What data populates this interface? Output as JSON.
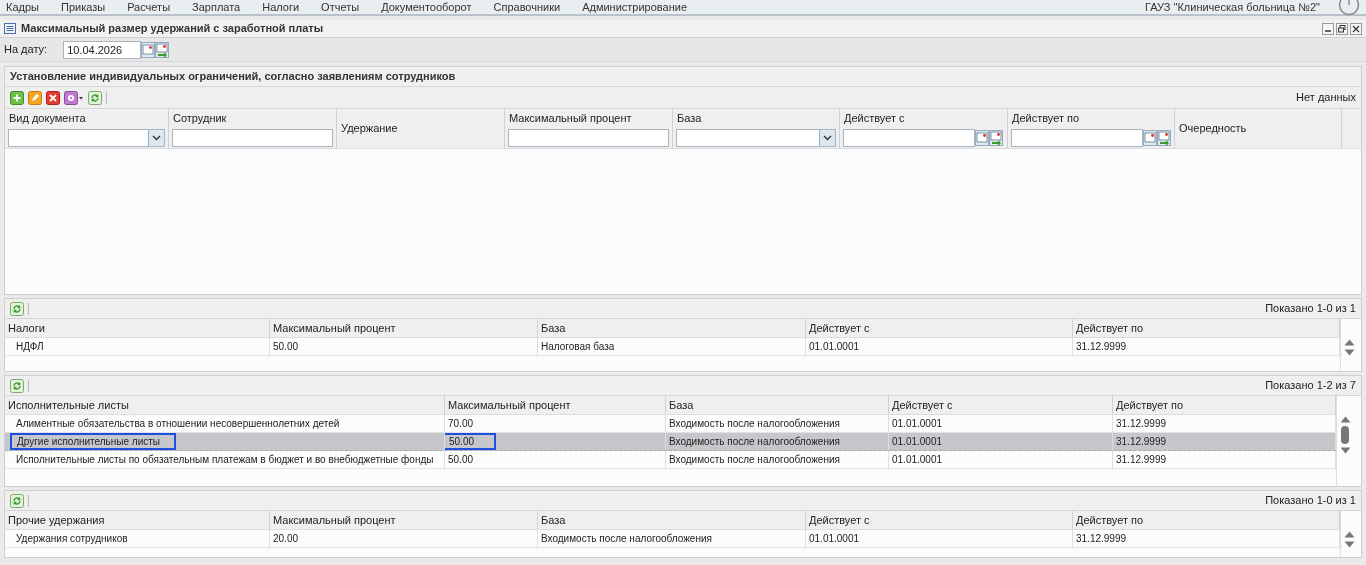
{
  "menu": [
    "Кадры",
    "Приказы",
    "Расчеты",
    "Зарплата",
    "Налоги",
    "Отчеты",
    "Документооборот",
    "Справочники",
    "Администрирование"
  ],
  "organization": "ГАУЗ \"Клиническая больница №2\"",
  "window": {
    "title": "Максимальный размер удержаний с заработной платы"
  },
  "date_filter": {
    "label": "На дату:",
    "value": "10.04.2026"
  },
  "individual_limits": {
    "title": "Установление индивидуальных ограничений, согласно заявлениям сотрудников",
    "status": "Нет данных",
    "columns": [
      {
        "label": "Вид документа",
        "kind": "dropdown"
      },
      {
        "label": "Сотрудник",
        "kind": "text"
      },
      {
        "label": "Удержание",
        "kind": "none"
      },
      {
        "label": "Максимальный процент",
        "kind": "text"
      },
      {
        "label": "База",
        "kind": "dropdown"
      },
      {
        "label": "Действует с",
        "kind": "date"
      },
      {
        "label": "Действует по",
        "kind": "date"
      },
      {
        "label": "Очередность",
        "kind": "none"
      }
    ]
  },
  "grids": [
    {
      "status": "Показано 1-0 из 1",
      "columns": [
        "Налоги",
        "Максимальный процент",
        "База",
        "Действует с",
        "Действует по"
      ],
      "rows": [
        {
          "selected": false,
          "cells": [
            {
              "text": "НДФЛ",
              "outlined": false
            },
            {
              "text": "50.00",
              "outlined": false
            },
            {
              "text": "Налоговая база",
              "outlined": false
            },
            {
              "text": "01.01.0001",
              "outlined": false
            },
            {
              "text": "31.12.9999",
              "outlined": false
            }
          ]
        }
      ]
    },
    {
      "status": "Показано 1-2 из 7",
      "columns": [
        "Исполнительные листы",
        "Максимальный процент",
        "База",
        "Действует с",
        "Действует по"
      ],
      "rows": [
        {
          "selected": false,
          "cells": [
            {
              "text": "Алиментные обязательства в отношении несовершеннолетних детей",
              "outlined": false
            },
            {
              "text": "70.00",
              "outlined": false
            },
            {
              "text": "Входимость после налогообложения",
              "outlined": false
            },
            {
              "text": "01.01.0001",
              "outlined": false
            },
            {
              "text": "31.12.9999",
              "outlined": false
            }
          ]
        },
        {
          "selected": true,
          "cells": [
            {
              "text": "Другие исполнительные листы",
              "outlined": true
            },
            {
              "text": "50.00",
              "outlined": true
            },
            {
              "text": "Входимость после налогообложения",
              "outlined": false
            },
            {
              "text": "01.01.0001",
              "outlined": false
            },
            {
              "text": "31.12.9999",
              "outlined": false
            }
          ]
        },
        {
          "selected": false,
          "cells": [
            {
              "text": "Исполнительные листы по обязательным платежам в бюджет и во внебюджетные фонды",
              "outlined": false
            },
            {
              "text": "50.00",
              "outlined": false
            },
            {
              "text": "Входимость после налогообложения",
              "outlined": false
            },
            {
              "text": "01.01.0001",
              "outlined": false
            },
            {
              "text": "31.12.9999",
              "outlined": false
            }
          ]
        }
      ]
    },
    {
      "status": "Показано 1-0 из 1",
      "columns": [
        "Прочие удержания",
        "Максимальный процент",
        "База",
        "Действует с",
        "Действует по"
      ],
      "rows": [
        {
          "selected": false,
          "cells": [
            {
              "text": "Удержания сотрудников",
              "outlined": false
            },
            {
              "text": "20.00",
              "outlined": false
            },
            {
              "text": "Входимость после налогообложения",
              "outlined": false
            },
            {
              "text": "01.01.0001",
              "outlined": false
            },
            {
              "text": "31.12.9999",
              "outlined": false
            }
          ]
        }
      ]
    }
  ]
}
